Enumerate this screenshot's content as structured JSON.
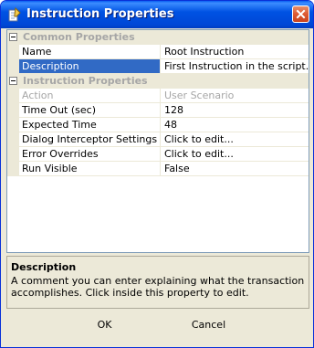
{
  "window": {
    "title": "Instruction Properties"
  },
  "titlebar": {
    "app_icon": "pencil-paper-icon",
    "close_icon": "close-x-icon"
  },
  "grid": {
    "categories": [
      {
        "label": "Common Properties",
        "properties": [
          {
            "name": "Name",
            "value": "Root Instruction",
            "selected": false,
            "disabled": false
          },
          {
            "name": "Description",
            "value": "First Instruction in the script.",
            "selected": true,
            "disabled": false
          }
        ]
      },
      {
        "label": "Instruction Properties",
        "properties": [
          {
            "name": "Action",
            "value": "User Scenario",
            "selected": false,
            "disabled": true
          },
          {
            "name": "Time Out (sec)",
            "value": "128",
            "selected": false,
            "disabled": false
          },
          {
            "name": "Expected Time",
            "value": "48",
            "selected": false,
            "disabled": false
          },
          {
            "name": "Dialog Interceptor Settings",
            "value": "Click to edit...",
            "selected": false,
            "disabled": false
          },
          {
            "name": "Error Overrides",
            "value": "Click to edit...",
            "selected": false,
            "disabled": false
          },
          {
            "name": "Run Visible",
            "value": "False",
            "selected": false,
            "disabled": false
          }
        ]
      }
    ]
  },
  "description": {
    "title": "Description",
    "text": "A comment you can enter explaining what the transaction accomplishes.  Click inside this property to edit."
  },
  "buttons": {
    "ok_label": "OK",
    "cancel_label": "Cancel"
  },
  "colors": {
    "titlebar": "#0052E3",
    "selection": "#316AC5",
    "dialog_bg": "#ECE9D8",
    "disabled_text": "#A6A6A6"
  }
}
